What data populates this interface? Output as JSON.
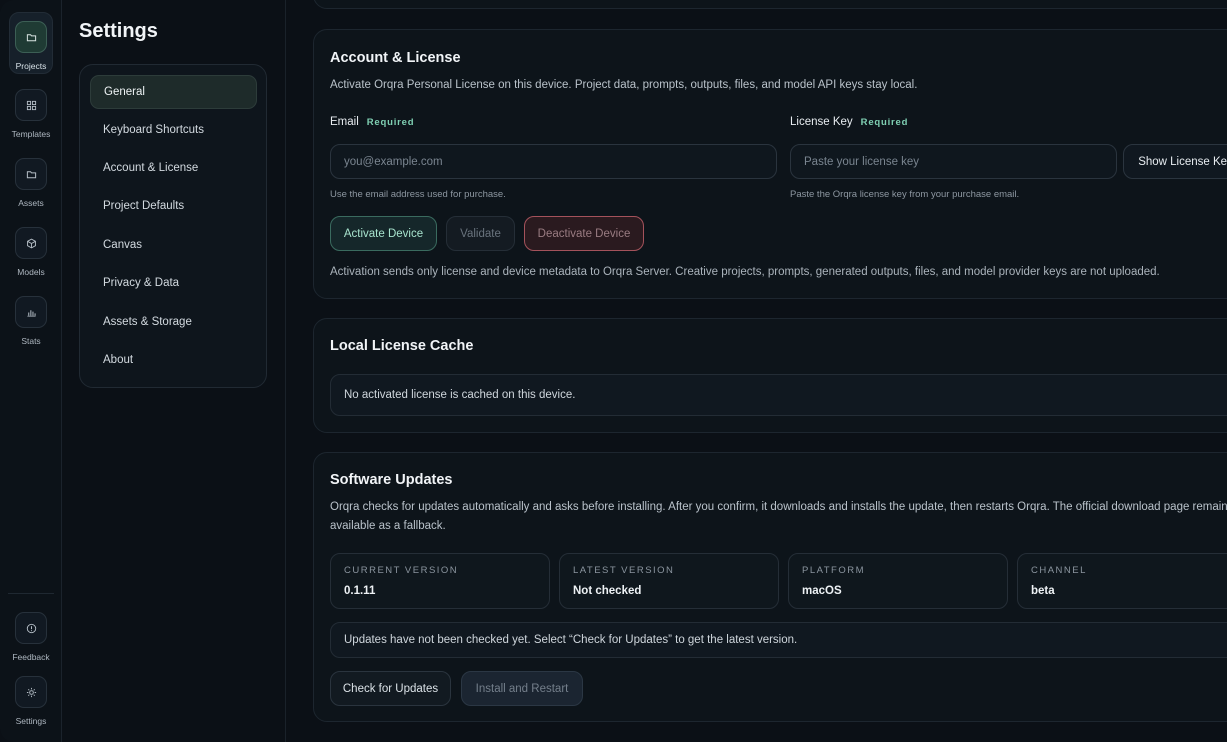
{
  "rail": {
    "items": [
      {
        "label": "Projects",
        "icon": "folder-icon"
      },
      {
        "label": "Templates",
        "icon": "grid-icon"
      },
      {
        "label": "Assets",
        "icon": "folder-icon"
      },
      {
        "label": "Models",
        "icon": "cube-icon"
      },
      {
        "label": "Stats",
        "icon": "bar-chart-icon"
      }
    ],
    "bottom": [
      {
        "label": "Feedback",
        "icon": "info-circle-icon"
      },
      {
        "label": "Settings",
        "icon": "gear-icon"
      }
    ]
  },
  "settings_nav": {
    "title": "Settings",
    "items": [
      {
        "label": "General"
      },
      {
        "label": "Keyboard Shortcuts"
      },
      {
        "label": "Account & License"
      },
      {
        "label": "Project Defaults"
      },
      {
        "label": "Canvas"
      },
      {
        "label": "Privacy & Data"
      },
      {
        "label": "Assets & Storage"
      },
      {
        "label": "About"
      }
    ]
  },
  "account": {
    "title": "Account & License",
    "description": "Activate Orqra Personal License on this device. Project data, prompts, outputs, files, and model API keys stay local.",
    "email_label": "Email",
    "required": "Required",
    "email_placeholder": "you@example.com",
    "email_hint": "Use the email address used for purchase.",
    "license_label": "License Key",
    "license_placeholder": "Paste your license key",
    "license_hint": "Paste the Orqra license key from your purchase email.",
    "show_key_button": "Show License Key",
    "activate_button": "Activate Device",
    "validate_button": "Validate",
    "deactivate_button": "Deactivate Device",
    "note": "Activation sends only license and device metadata to Orqra Server. Creative projects, prompts, generated outputs, files, and model provider keys are not uploaded."
  },
  "cache": {
    "title": "Local License Cache",
    "message": "No activated license is cached on this device."
  },
  "updates": {
    "title": "Software Updates",
    "description_line1": "Orqra checks for updates automatically and asks before installing. After you confirm, it downloads and installs the update, then restarts Orqra. The official download page remains",
    "description_line2": "available as a fallback.",
    "stats": [
      {
        "label": "CURRENT VERSION",
        "value": "0.1.11"
      },
      {
        "label": "LATEST VERSION",
        "value": "Not checked"
      },
      {
        "label": "PLATFORM",
        "value": "macOS"
      },
      {
        "label": "CHANNEL",
        "value": "beta"
      }
    ],
    "status": "Updates have not been checked yet. Select “Check for Updates” to get the latest version.",
    "check_button": "Check for Updates",
    "install_button": "Install and Restart"
  },
  "colors": {
    "accent": "#7fd0b3",
    "danger": "#a4525b",
    "background": "#0b1016"
  }
}
